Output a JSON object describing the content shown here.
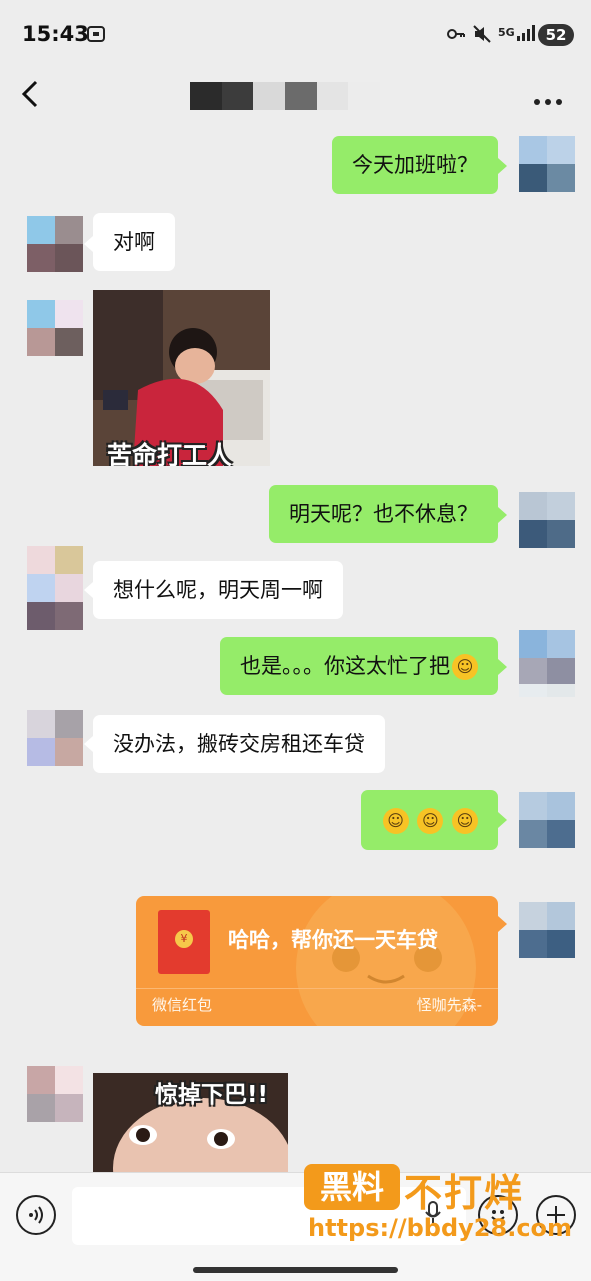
{
  "status": {
    "time": "15:43",
    "icons": [
      "screen-record-icon",
      "key-icon",
      "mute-icon",
      "5g-icon",
      "signal-icon"
    ],
    "network": "5G",
    "battery": "52"
  },
  "header": {
    "back_icon": "chevron-left-icon",
    "more_icon": "more-dots-icon"
  },
  "messages": [
    {
      "side": "right",
      "type": "text",
      "text": "今天加班啦？"
    },
    {
      "side": "left",
      "type": "text",
      "text": "对啊"
    },
    {
      "side": "left",
      "type": "sticker",
      "caption": "苦命打工人"
    },
    {
      "side": "right",
      "type": "text",
      "text": "明天呢？也不休息？"
    },
    {
      "side": "left",
      "type": "text",
      "text": "想什么呢，明天周一啊"
    },
    {
      "side": "right",
      "type": "text",
      "text": "也是。。。你这太忙了把",
      "emoji": "grin-sweat-emoji"
    },
    {
      "side": "left",
      "type": "text",
      "text": "没办法，搬砖交房租还车贷"
    },
    {
      "side": "right",
      "type": "emoji",
      "emoji": "grin-sweat-emoji",
      "count": 3
    },
    {
      "side": "right",
      "type": "red_packet",
      "text": "哈哈，帮你还一天车贷",
      "label": "微信红包",
      "sender": "怪咖先森-"
    },
    {
      "side": "left",
      "type": "sticker",
      "caption": "惊掉下巴!!"
    }
  ],
  "input": {
    "voice_icon": "voice-icon",
    "mic_icon": "mic-icon",
    "emoji_icon": "smile-icon",
    "plus_icon": "plus-icon"
  },
  "watermark": {
    "box_text": "黑料",
    "text": "不打烊",
    "url": "https://bbdy28.com"
  },
  "colors": {
    "background": "#ededed",
    "my_bubble": "#95ec69",
    "their_bubble": "#ffffff",
    "red_packet": "#f89a3c",
    "watermark": "#f39a1b"
  }
}
